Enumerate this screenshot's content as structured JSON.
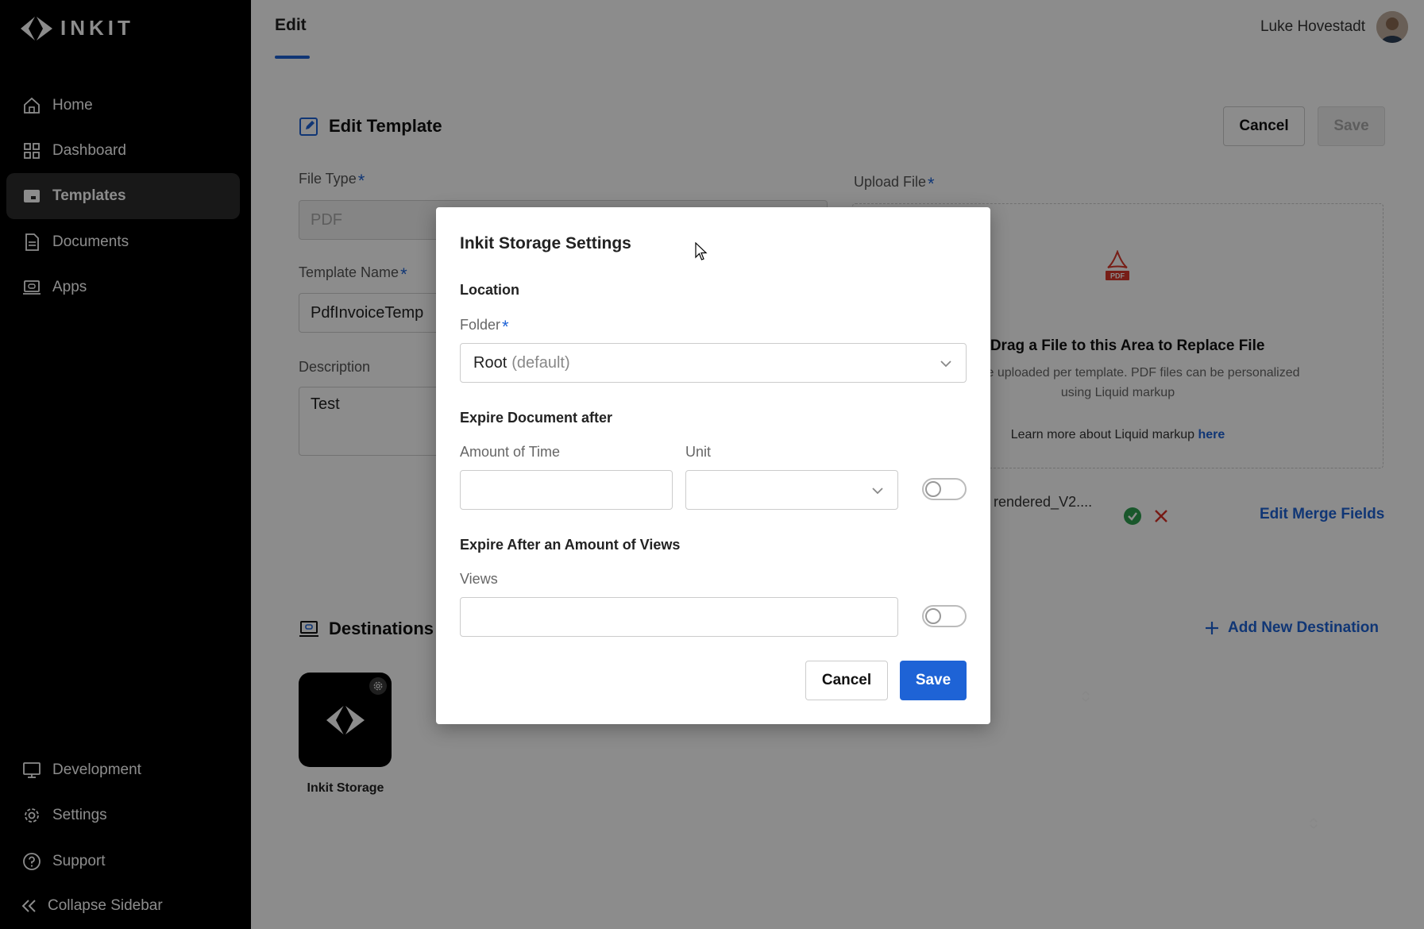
{
  "sidebar": {
    "logo_text": "INKIT",
    "items": [
      {
        "label": "Home"
      },
      {
        "label": "Dashboard"
      },
      {
        "label": "Templates"
      },
      {
        "label": "Documents"
      },
      {
        "label": "Apps"
      }
    ],
    "bottom_items": [
      {
        "label": "Development"
      },
      {
        "label": "Settings"
      },
      {
        "label": "Support"
      }
    ],
    "collapse_label": "Collapse Sidebar"
  },
  "header": {
    "tab": "Edit",
    "user_name": "Luke Hovestadt"
  },
  "edit_template": {
    "title": "Edit Template",
    "cancel_label": "Cancel",
    "save_label": "Save",
    "file_type_label": "File Type",
    "file_type_value": "PDF",
    "template_name_label": "Template Name",
    "template_name_value": "PdfInvoiceTemp",
    "description_label": "Description",
    "description_value": "Test",
    "required_mark": "*",
    "upload_label": "Upload File",
    "upload_title": "or Drag a File to this Area to Replace File",
    "upload_sub": "file can be uploaded per template. PDF files can be personalized using Liquid markup",
    "learn_text": "Learn more about Liquid markup",
    "learn_link": "here",
    "file_name": "rendered_V2....",
    "edit_merge_fields": "Edit Merge Fields",
    "pdf_badge": "PDF"
  },
  "destinations": {
    "title": "Destinations",
    "add_label": "Add New Destination",
    "items": [
      {
        "label": "Inkit Storage"
      }
    ]
  },
  "modal": {
    "title": "Inkit Storage Settings",
    "location_heading": "Location",
    "folder_label": "Folder",
    "folder_value": "Root",
    "folder_hint": "(default)",
    "expire_heading": "Expire Document after",
    "amount_label": "Amount of Time",
    "amount_value": "",
    "unit_label": "Unit",
    "unit_value": "",
    "expire_toggle_on": false,
    "views_heading": "Expire After an Amount of Views",
    "views_label": "Views",
    "views_value": "",
    "views_toggle_on": false,
    "cancel_label": "Cancel",
    "save_label": "Save"
  },
  "colors": {
    "accent": "#1e63d6",
    "sidebar_bg": "#000000",
    "success": "#2e9e4f",
    "danger": "#d93025",
    "pdf_red": "#d9382b"
  }
}
